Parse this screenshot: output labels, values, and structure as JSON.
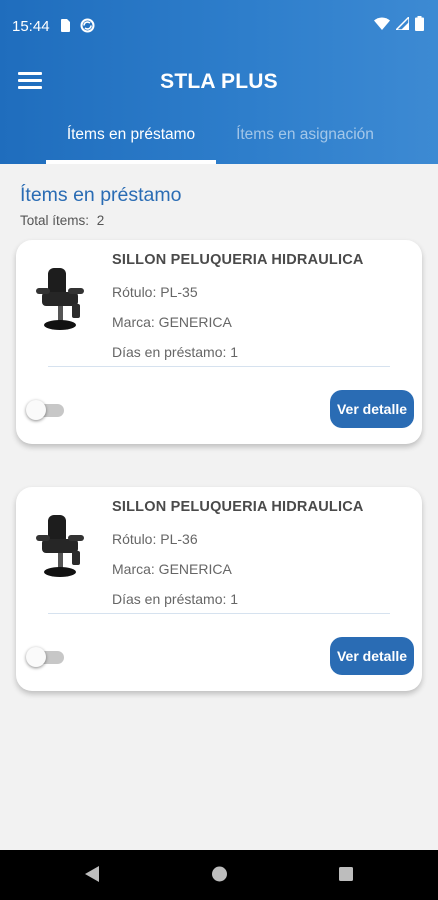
{
  "status_bar": {
    "time": "15:44"
  },
  "app_bar": {
    "title": "STLA PLUS"
  },
  "tabs": [
    {
      "label": "Ítems en préstamo",
      "active": true
    },
    {
      "label": "Ítems en asignación",
      "active": false
    }
  ],
  "section": {
    "title": "Ítems en préstamo",
    "total_label": "Total ítems:",
    "total_value": "2"
  },
  "items": [
    {
      "name": "SILLON PELUQUERIA HIDRAULICA",
      "rotulo": "Rótulo: PL-35",
      "marca": "Marca: GENERICA",
      "dias": "Días en préstamo: 1",
      "detail_label": "Ver detalle",
      "toggle_on": false
    },
    {
      "name": "SILLON PELUQUERIA HIDRAULICA",
      "rotulo": "Rótulo: PL-36",
      "marca": "Marca: GENERICA",
      "dias": "Días en préstamo: 1",
      "detail_label": "Ver detalle",
      "toggle_on": false
    }
  ],
  "colors": {
    "primary": "#2a6cb4",
    "header": "#1f6dbd",
    "background": "#f2f2f2"
  },
  "icons": [
    "menu-icon",
    "sim-card-icon",
    "sync-icon",
    "wifi-icon",
    "signal-icon",
    "battery-icon",
    "back-icon",
    "home-icon",
    "recents-icon"
  ]
}
